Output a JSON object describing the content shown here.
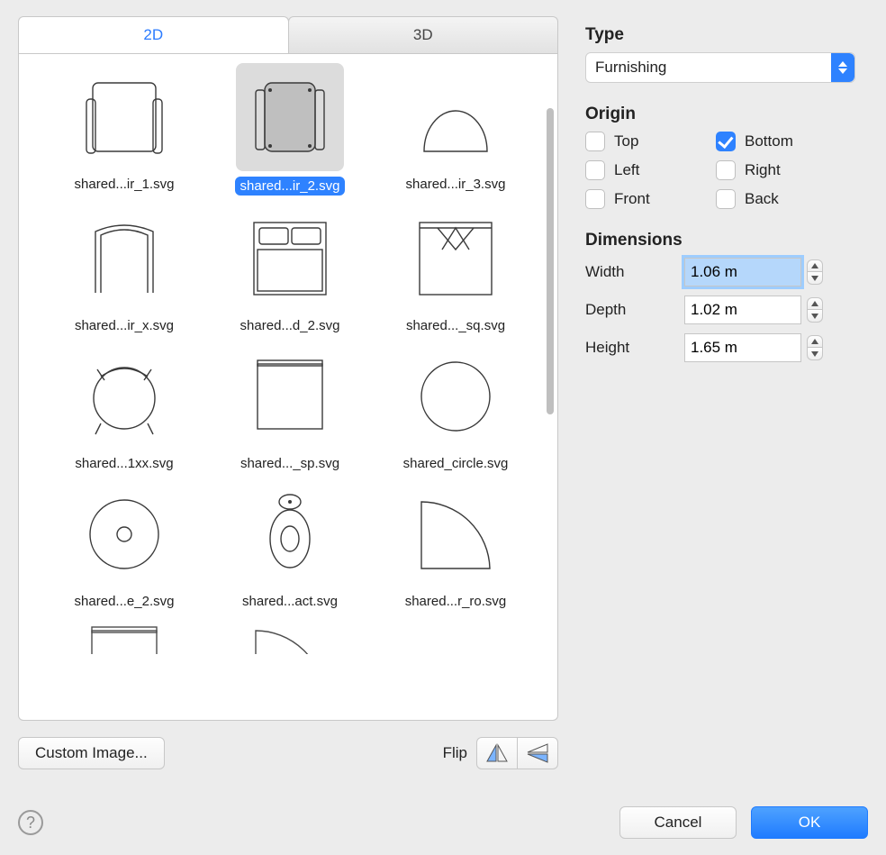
{
  "tabs": {
    "tab_2d": "2D",
    "tab_3d": "3D"
  },
  "gallery": {
    "items": [
      {
        "caption": "shared...ir_1.svg",
        "shape": "armchair1",
        "selected": false
      },
      {
        "caption": "shared...ir_2.svg",
        "shape": "armchair2",
        "selected": true
      },
      {
        "caption": "shared...ir_3.svg",
        "shape": "arch",
        "selected": false
      },
      {
        "caption": "shared...ir_x.svg",
        "shape": "headboard",
        "selected": false
      },
      {
        "caption": "shared...d_2.svg",
        "shape": "bed",
        "selected": false
      },
      {
        "caption": "shared..._sq.svg",
        "shape": "square_folded",
        "selected": false
      },
      {
        "caption": "shared...1xx.svg",
        "shape": "stool",
        "selected": false
      },
      {
        "caption": "shared..._sp.svg",
        "shape": "block",
        "selected": false
      },
      {
        "caption": "shared_circle.svg",
        "shape": "circle",
        "selected": false
      },
      {
        "caption": "shared...e_2.svg",
        "shape": "ring",
        "selected": false
      },
      {
        "caption": "shared...act.svg",
        "shape": "toilet",
        "selected": false
      },
      {
        "caption": "shared...r_ro.svg",
        "shape": "quarter",
        "selected": false
      }
    ]
  },
  "bottom": {
    "custom_image": "Custom Image...",
    "flip_label": "Flip"
  },
  "type": {
    "label": "Type",
    "value": "Furnishing"
  },
  "origin": {
    "label": "Origin",
    "options": {
      "top": {
        "label": "Top",
        "checked": false
      },
      "bottom": {
        "label": "Bottom",
        "checked": true
      },
      "left": {
        "label": "Left",
        "checked": false
      },
      "right": {
        "label": "Right",
        "checked": false
      },
      "front": {
        "label": "Front",
        "checked": false
      },
      "back": {
        "label": "Back",
        "checked": false
      }
    }
  },
  "dimensions": {
    "label": "Dimensions",
    "width": {
      "label": "Width",
      "value": "1.06 m",
      "focused": true
    },
    "depth": {
      "label": "Depth",
      "value": "1.02 m",
      "focused": false
    },
    "height": {
      "label": "Height",
      "value": "1.65 m",
      "focused": false
    }
  },
  "footer": {
    "help": "?",
    "cancel": "Cancel",
    "ok": "OK"
  }
}
